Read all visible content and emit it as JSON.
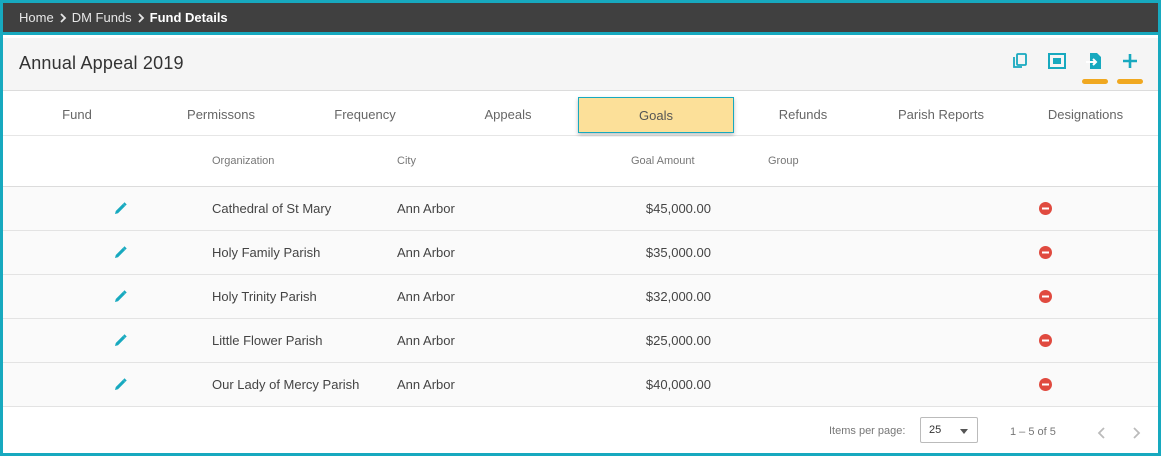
{
  "breadcrumb": {
    "items": [
      "Home",
      "DM Funds",
      "Fund Details"
    ]
  },
  "header": {
    "title": "Annual Appeal 2019",
    "accent_color": "#17a9bf",
    "highlight_color": "#f0a820",
    "tools": [
      "copy-icon",
      "fit-screen-icon",
      "import-file-icon",
      "plus-icon"
    ]
  },
  "tabs": {
    "items": [
      "Fund",
      "Permissons",
      "Frequency",
      "Appeals",
      "Goals",
      "Refunds",
      "Parish Reports",
      "Designations"
    ],
    "active": "Goals"
  },
  "table": {
    "columns": [
      "Organization",
      "City",
      "Goal Amount",
      "Group"
    ],
    "rows": [
      {
        "organization": "Cathedral of St Mary",
        "city": "Ann Arbor",
        "goal_amount": "$45,000.00",
        "group": ""
      },
      {
        "organization": "Holy Family Parish",
        "city": "Ann Arbor",
        "goal_amount": "$35,000.00",
        "group": ""
      },
      {
        "organization": "Holy Trinity Parish",
        "city": "Ann Arbor",
        "goal_amount": "$32,000.00",
        "group": ""
      },
      {
        "organization": "Little Flower Parish",
        "city": "Ann Arbor",
        "goal_amount": "$25,000.00",
        "group": ""
      },
      {
        "organization": "Our Lady of Mercy Parish",
        "city": "Ann Arbor",
        "goal_amount": "$40,000.00",
        "group": ""
      }
    ],
    "row_icons": {
      "edit": "pencil-icon",
      "delete": "remove-circle-icon"
    },
    "delete_color": "#e04a3f"
  },
  "paginator": {
    "label": "Items per page:",
    "page_size": "25",
    "range": "1 – 5 of 5"
  }
}
